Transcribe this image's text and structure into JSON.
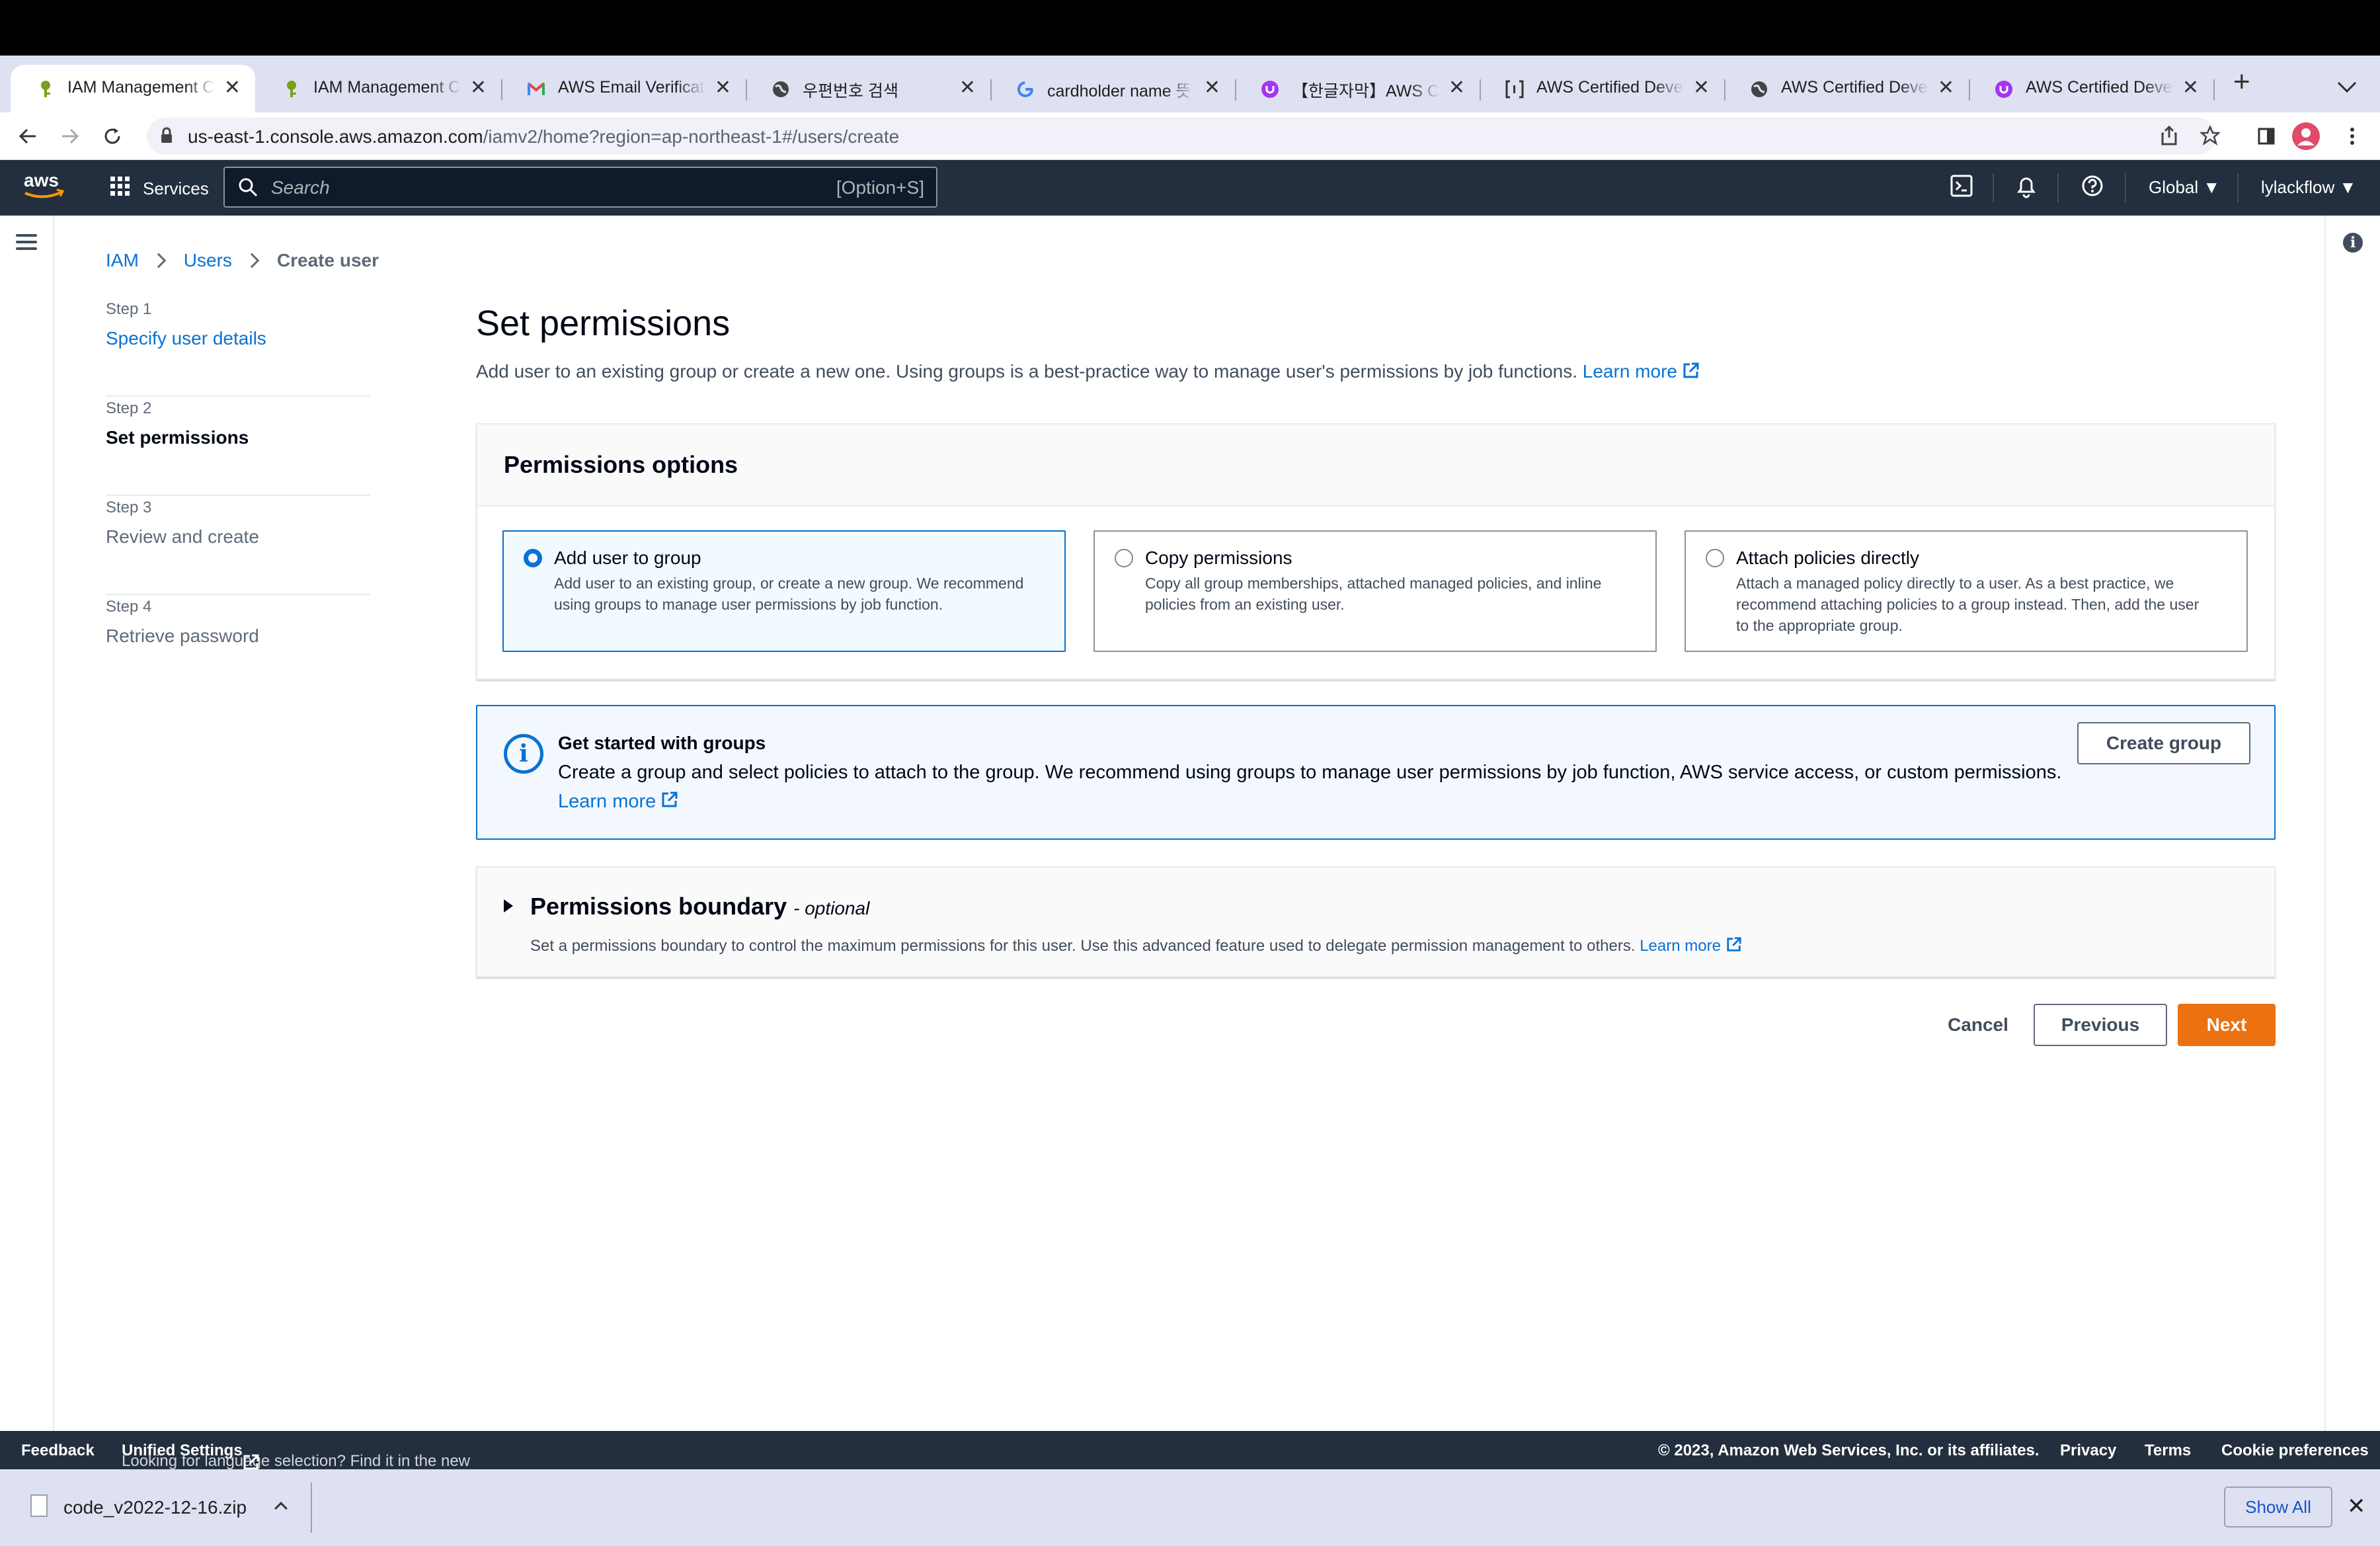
{
  "browser": {
    "tabs": [
      {
        "title": "IAM Management Con",
        "icon": "iam-key-icon",
        "active": true
      },
      {
        "title": "IAM Management Con",
        "icon": "iam-key-icon",
        "active": false
      },
      {
        "title": "AWS Email Verificatio",
        "icon": "gmail-icon",
        "active": false
      },
      {
        "title": "우편번호 검색",
        "icon": "globe-icon",
        "active": false
      },
      {
        "title": "cardholder name 뜻 -",
        "icon": "google-icon",
        "active": false
      },
      {
        "title": "【한글자막】AWS Certifie",
        "icon": "udemy-icon",
        "active": false
      },
      {
        "title": "AWS Certified Develo",
        "icon": "bracket-icon",
        "active": false
      },
      {
        "title": "AWS Certified Develo",
        "icon": "globe-icon",
        "active": false
      },
      {
        "title": "AWS Certified Develo",
        "icon": "udemy-icon",
        "active": false
      }
    ],
    "close_glyph": "✕",
    "newtab_glyph": "+",
    "url_host": "us-east-1.console.aws.amazon.com",
    "url_path": "/iamv2/home?region=ap-northeast-1#/users/create"
  },
  "aws_header": {
    "services_label": "Services",
    "search_placeholder": "Search",
    "search_shortcut": "[Option+S]",
    "region_label": "Global",
    "user_label": "lylackflow"
  },
  "breadcrumb": {
    "items": [
      "IAM",
      "Users"
    ],
    "current": "Create user"
  },
  "wizard_steps": [
    {
      "num": "Step 1",
      "name": "Specify user details",
      "state": "link"
    },
    {
      "num": "Step 2",
      "name": "Set permissions",
      "state": "active"
    },
    {
      "num": "Step 3",
      "name": "Review and create",
      "state": "disabled"
    },
    {
      "num": "Step 4",
      "name": "Retrieve password",
      "state": "disabled"
    }
  ],
  "page": {
    "title": "Set permissions",
    "subtitle": "Add user to an existing group or create a new one. Using groups is a best-practice way to manage user's permissions by job functions.",
    "learn_more": "Learn more"
  },
  "permissions_options": {
    "heading": "Permissions options",
    "options": [
      {
        "title": "Add user to group",
        "desc": "Add user to an existing group, or create a new group. We recommend using groups to manage user permissions by job function.",
        "selected": true
      },
      {
        "title": "Copy permissions",
        "desc": "Copy all group memberships, attached managed policies, and inline policies from an existing user.",
        "selected": false
      },
      {
        "title": "Attach policies directly",
        "desc": "Attach a managed policy directly to a user. As a best practice, we recommend attaching policies to a group instead. Then, add the user to the appropriate group.",
        "selected": false
      }
    ]
  },
  "groups_info": {
    "title": "Get started with groups",
    "desc": "Create a group and select policies to attach to the group. We recommend using groups to manage user permissions by job function, AWS service access, or custom permissions.",
    "learn_more": "Learn more",
    "button": "Create group"
  },
  "permissions_boundary": {
    "title": "Permissions boundary",
    "optional": "- optional",
    "desc": "Set a permissions boundary to control the maximum permissions for this user. Use this advanced feature used to delegate permission management to others.",
    "learn_more": "Learn more"
  },
  "actions": {
    "cancel": "Cancel",
    "previous": "Previous",
    "next": "Next"
  },
  "footer": {
    "feedback": "Feedback",
    "lang_text": "Looking for language selection? Find it in the new",
    "unified": "Unified Settings",
    "copyright": "© 2023, Amazon Web Services, Inc. or its affiliates.",
    "privacy": "Privacy",
    "terms": "Terms",
    "cookie": "Cookie preferences"
  },
  "downloads": {
    "filename": "code_v2022-12-16.zip",
    "show_all": "Show All"
  },
  "colors": {
    "aws_nav": "#232f3e",
    "link_blue": "#0972d3",
    "primary_orange": "#ec7211",
    "tabstrip": "#dee1f2"
  }
}
